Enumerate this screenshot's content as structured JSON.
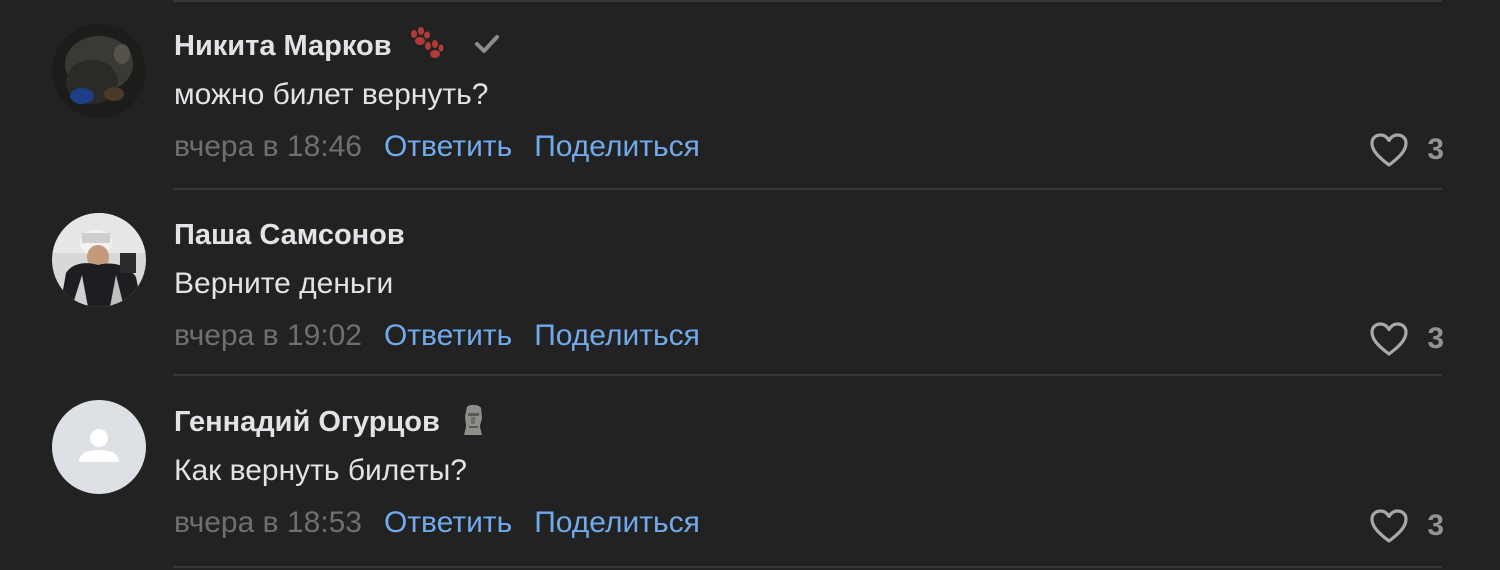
{
  "comments": [
    {
      "author": "Никита Марков",
      "text": "можно билет вернуть?",
      "time": "вчера в 18:46",
      "reply_label": "Ответить",
      "share_label": "Поделиться",
      "likes": "3",
      "badges": [
        "paw-prints-icon",
        "checkmark-icon"
      ]
    },
    {
      "author": "Паша Самсонов",
      "text": "Верните деньги",
      "time": "вчера в 19:02",
      "reply_label": "Ответить",
      "share_label": "Поделиться",
      "likes": "3",
      "badges": []
    },
    {
      "author": "Геннадий Огурцов",
      "text": "Как вернуть билеты?",
      "time": "вчера в 18:53",
      "reply_label": "Ответить",
      "share_label": "Поделиться",
      "likes": "3",
      "badges": [
        "moai-icon"
      ]
    }
  ],
  "colors": {
    "background": "#222222",
    "text": "#e1e3e6",
    "muted": "#6d6f71",
    "link": "#71aaeb",
    "divider": "#363738"
  }
}
